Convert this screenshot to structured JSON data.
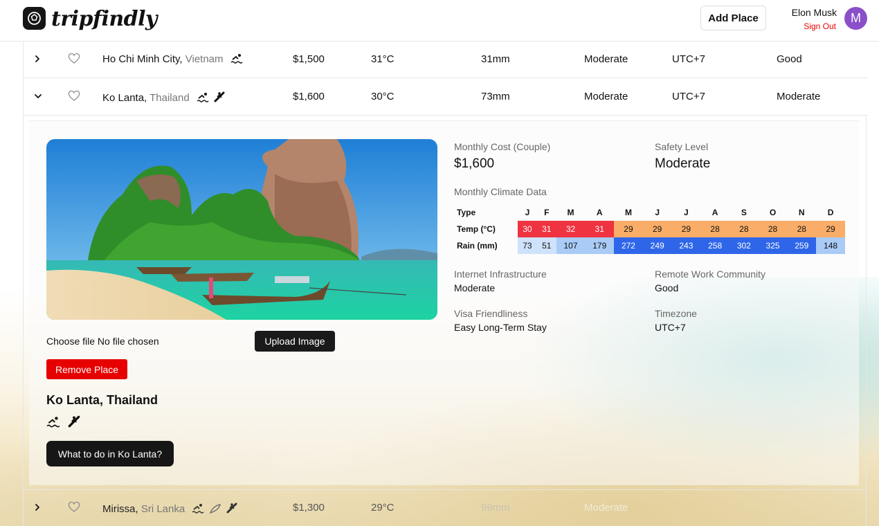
{
  "header": {
    "logo_text": "tripfindly",
    "add_place_label": "Add Place",
    "user_name": "Elon Musk",
    "sign_out_label": "Sign Out",
    "avatar_initial": "M"
  },
  "rows": [
    {
      "city": "Ho Chi Minh City,",
      "country": "Vietnam",
      "activities": [
        "swim-icon"
      ],
      "cost": "$1,500",
      "temp": "31°C",
      "rain": "31mm",
      "safety": "Moderate",
      "timezone": "UTC+7",
      "internet": "Good",
      "expanded": false
    },
    {
      "city": "Ko Lanta,",
      "country": "Thailand",
      "activities": [
        "swim-icon",
        "surf-icon"
      ],
      "cost": "$1,600",
      "temp": "30°C",
      "rain": "73mm",
      "safety": "Moderate",
      "timezone": "UTC+7",
      "internet": "Moderate",
      "expanded": true
    },
    {
      "city": "Mirissa,",
      "country": "Sri Lanka",
      "activities": [
        "swim-icon",
        "surfboard-icon",
        "surf-icon"
      ],
      "cost": "$1,300",
      "temp": "29°C",
      "rain": "99mm",
      "safety": "Moderate",
      "expanded": false
    }
  ],
  "detail": {
    "file_label": "Choose file No file chosen",
    "upload_label": "Upload Image",
    "remove_label": "Remove Place",
    "title": "Ko Lanta, Thailand",
    "what_to_do_label": "What to do in Ko Lanta?",
    "monthly_cost_label": "Monthly Cost (Couple)",
    "monthly_cost_value": "$1,600",
    "safety_label": "Safety Level",
    "safety_value": "Moderate",
    "climate_label": "Monthly Climate Data",
    "internet_label": "Internet Infrastructure",
    "internet_value": "Moderate",
    "community_label": "Remote Work Community",
    "community_value": "Good",
    "visa_label": "Visa Friendliness",
    "visa_value": "Easy Long-Term Stay",
    "timezone_label": "Timezone",
    "timezone_value": "UTC+7"
  },
  "climate": {
    "type_header": "Type",
    "months": [
      "J",
      "F",
      "M",
      "A",
      "M",
      "J",
      "J",
      "A",
      "S",
      "O",
      "N",
      "D"
    ],
    "temp_label": "Temp (°C)",
    "temp": [
      30,
      31,
      32,
      31,
      29,
      29,
      29,
      28,
      28,
      28,
      28,
      29
    ],
    "rain_label": "Rain (mm)",
    "rain": [
      73,
      51,
      107,
      179,
      272,
      249,
      243,
      258,
      302,
      325,
      259,
      148
    ]
  },
  "colors": {
    "temp_hot": "#ef3340",
    "temp_warm": "#f9ad68",
    "rain_low": "#cfe2fb",
    "rain_mid": "#a9cbf6",
    "rain_high": "#2f66e9",
    "accent_red": "#e60000",
    "avatar": "#8b4fc9"
  }
}
